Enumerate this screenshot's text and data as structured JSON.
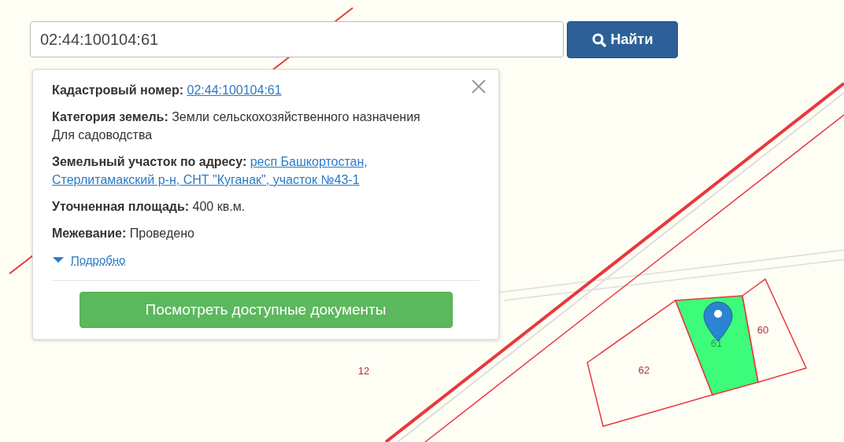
{
  "search": {
    "value": "02:44:100104:61",
    "button": "Найти"
  },
  "popup": {
    "fields": [
      {
        "kind": "link",
        "label": "Кадастровый номер:",
        "value": "02:44:100104:61"
      },
      {
        "kind": "text",
        "label": "Категория земель:",
        "value": "Земли сельскохозяйственного назначения",
        "extra": "Для садоводства"
      },
      {
        "kind": "link",
        "label": "Земельный участок по адресу:",
        "lines": [
          "респ Башкортостан,",
          "Стерлитамакский р-н, СНТ \"Куганак\", участок №43-1"
        ]
      },
      {
        "kind": "text",
        "label": "Уточненная площадь:",
        "value": "400 кв.м."
      },
      {
        "kind": "text",
        "label": "Межевание:",
        "value": "Проведено"
      }
    ],
    "more": {
      "label": "Подробно",
      "expanded": false
    },
    "action": "Посмотреть доступные документы"
  },
  "map": {
    "parcels": [
      {
        "label": "62",
        "selected": false
      },
      {
        "label": "61",
        "selected": true
      },
      {
        "label": "60",
        "selected": false
      }
    ],
    "block_label": "12"
  }
}
